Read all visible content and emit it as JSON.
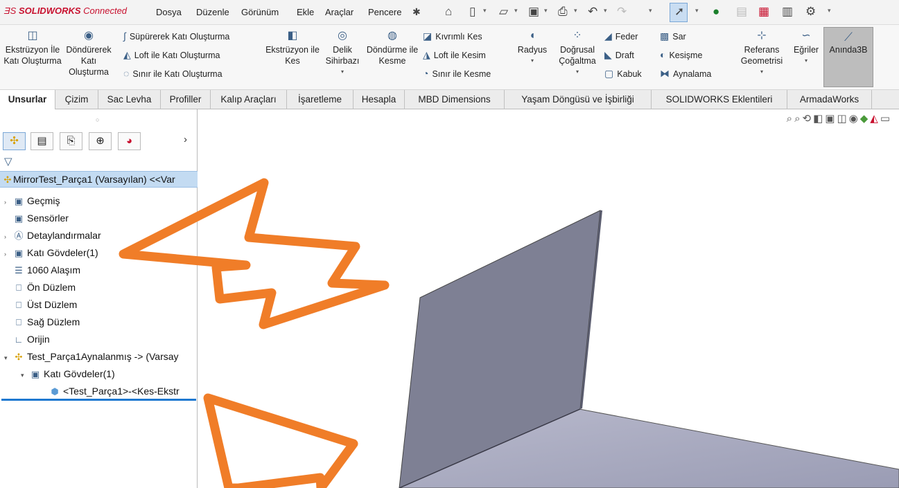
{
  "app": {
    "brand_prefix": "SOLIDWORKS",
    "brand_suffix": " Connected"
  },
  "menu": [
    "Dosya",
    "Düzenle",
    "Görünüm",
    "Ekle",
    "Araçlar",
    "Pencere"
  ],
  "ribbon": {
    "extrude": "Ekstrüzyon İle Katı Oluşturma",
    "revolve": "Döndürerek Katı Oluşturma",
    "sweep": "Süpürerek Katı Oluşturma",
    "loft": "Loft ile Katı Oluşturma",
    "boundary": "Sınır ile Katı Oluşturma",
    "extrude_cut": "Ekstrüzyon ile Kes",
    "hole_wizard": "Delik Sihirbazı",
    "revolve_cut": "Döndürme ile Kesme",
    "swept_cut": "Kıvrımlı Kes",
    "loft_cut": "Loft ile Kesim",
    "boundary_cut": "Sınır ile Kesme",
    "fillet": "Radyus",
    "linear_pattern": "Doğrusal Çoğaltma",
    "rib": "Feder",
    "draft": "Draft",
    "shell": "Kabuk",
    "wrap": "Sar",
    "intersect": "Kesişme",
    "mirror": "Aynalama",
    "ref_geometry": "Referans Geometrisi",
    "curves": "Eğriler",
    "instant3d": "Anında3B"
  },
  "tabs": [
    "Unsurlar",
    "Çizim",
    "Sac Levha",
    "Profiller",
    "Kalıp Araçları",
    "İşaretleme",
    "Hesapla",
    "MBD Dimensions",
    "Yaşam Döngüsü ve İşbirliği",
    "SOLIDWORKS Eklentileri",
    "ArmadaWorks"
  ],
  "tree": {
    "root": "MirrorTest_Parça1 (Varsayılan) <<Var",
    "items": [
      "Geçmiş",
      "Sensörler",
      "Detaylandırmalar",
      "Katı Gövdeler(1)",
      "1060 Alaşım",
      "Ön Düzlem",
      "Üst Düzlem",
      "Sağ Düzlem",
      "Orijin",
      "Test_Parça1Aynalanmış -> (Varsay",
      "Katı Gövdeler(1)",
      "<Test_Parça1>-<Kes-Ekstr"
    ]
  },
  "colors": {
    "accent_orange": "#f07d28",
    "selection_blue": "#c3dbf2",
    "brand_red": "#c8102e"
  }
}
